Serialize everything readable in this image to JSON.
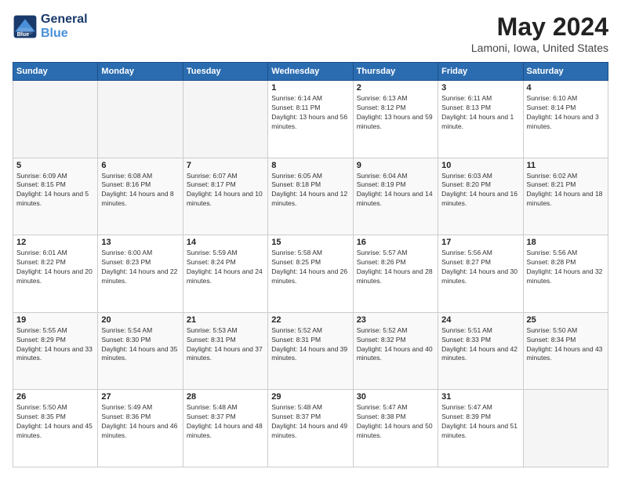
{
  "header": {
    "logo_line1": "General",
    "logo_line2": "Blue",
    "month_title": "May 2024",
    "location": "Lamoni, Iowa, United States"
  },
  "weekdays": [
    "Sunday",
    "Monday",
    "Tuesday",
    "Wednesday",
    "Thursday",
    "Friday",
    "Saturday"
  ],
  "weeks": [
    [
      {
        "day": "",
        "empty": true
      },
      {
        "day": "",
        "empty": true
      },
      {
        "day": "",
        "empty": true
      },
      {
        "day": "1",
        "sunrise": "6:14 AM",
        "sunset": "8:11 PM",
        "daylight": "13 hours and 56 minutes."
      },
      {
        "day": "2",
        "sunrise": "6:13 AM",
        "sunset": "8:12 PM",
        "daylight": "13 hours and 59 minutes."
      },
      {
        "day": "3",
        "sunrise": "6:11 AM",
        "sunset": "8:13 PM",
        "daylight": "14 hours and 1 minute."
      },
      {
        "day": "4",
        "sunrise": "6:10 AM",
        "sunset": "8:14 PM",
        "daylight": "14 hours and 3 minutes."
      }
    ],
    [
      {
        "day": "5",
        "sunrise": "6:09 AM",
        "sunset": "8:15 PM",
        "daylight": "14 hours and 5 minutes."
      },
      {
        "day": "6",
        "sunrise": "6:08 AM",
        "sunset": "8:16 PM",
        "daylight": "14 hours and 8 minutes."
      },
      {
        "day": "7",
        "sunrise": "6:07 AM",
        "sunset": "8:17 PM",
        "daylight": "14 hours and 10 minutes."
      },
      {
        "day": "8",
        "sunrise": "6:05 AM",
        "sunset": "8:18 PM",
        "daylight": "14 hours and 12 minutes."
      },
      {
        "day": "9",
        "sunrise": "6:04 AM",
        "sunset": "8:19 PM",
        "daylight": "14 hours and 14 minutes."
      },
      {
        "day": "10",
        "sunrise": "6:03 AM",
        "sunset": "8:20 PM",
        "daylight": "14 hours and 16 minutes."
      },
      {
        "day": "11",
        "sunrise": "6:02 AM",
        "sunset": "8:21 PM",
        "daylight": "14 hours and 18 minutes."
      }
    ],
    [
      {
        "day": "12",
        "sunrise": "6:01 AM",
        "sunset": "8:22 PM",
        "daylight": "14 hours and 20 minutes."
      },
      {
        "day": "13",
        "sunrise": "6:00 AM",
        "sunset": "8:23 PM",
        "daylight": "14 hours and 22 minutes."
      },
      {
        "day": "14",
        "sunrise": "5:59 AM",
        "sunset": "8:24 PM",
        "daylight": "14 hours and 24 minutes."
      },
      {
        "day": "15",
        "sunrise": "5:58 AM",
        "sunset": "8:25 PM",
        "daylight": "14 hours and 26 minutes."
      },
      {
        "day": "16",
        "sunrise": "5:57 AM",
        "sunset": "8:26 PM",
        "daylight": "14 hours and 28 minutes."
      },
      {
        "day": "17",
        "sunrise": "5:56 AM",
        "sunset": "8:27 PM",
        "daylight": "14 hours and 30 minutes."
      },
      {
        "day": "18",
        "sunrise": "5:56 AM",
        "sunset": "8:28 PM",
        "daylight": "14 hours and 32 minutes."
      }
    ],
    [
      {
        "day": "19",
        "sunrise": "5:55 AM",
        "sunset": "8:29 PM",
        "daylight": "14 hours and 33 minutes."
      },
      {
        "day": "20",
        "sunrise": "5:54 AM",
        "sunset": "8:30 PM",
        "daylight": "14 hours and 35 minutes."
      },
      {
        "day": "21",
        "sunrise": "5:53 AM",
        "sunset": "8:31 PM",
        "daylight": "14 hours and 37 minutes."
      },
      {
        "day": "22",
        "sunrise": "5:52 AM",
        "sunset": "8:31 PM",
        "daylight": "14 hours and 39 minutes."
      },
      {
        "day": "23",
        "sunrise": "5:52 AM",
        "sunset": "8:32 PM",
        "daylight": "14 hours and 40 minutes."
      },
      {
        "day": "24",
        "sunrise": "5:51 AM",
        "sunset": "8:33 PM",
        "daylight": "14 hours and 42 minutes."
      },
      {
        "day": "25",
        "sunrise": "5:50 AM",
        "sunset": "8:34 PM",
        "daylight": "14 hours and 43 minutes."
      }
    ],
    [
      {
        "day": "26",
        "sunrise": "5:50 AM",
        "sunset": "8:35 PM",
        "daylight": "14 hours and 45 minutes."
      },
      {
        "day": "27",
        "sunrise": "5:49 AM",
        "sunset": "8:36 PM",
        "daylight": "14 hours and 46 minutes."
      },
      {
        "day": "28",
        "sunrise": "5:48 AM",
        "sunset": "8:37 PM",
        "daylight": "14 hours and 48 minutes."
      },
      {
        "day": "29",
        "sunrise": "5:48 AM",
        "sunset": "8:37 PM",
        "daylight": "14 hours and 49 minutes."
      },
      {
        "day": "30",
        "sunrise": "5:47 AM",
        "sunset": "8:38 PM",
        "daylight": "14 hours and 50 minutes."
      },
      {
        "day": "31",
        "sunrise": "5:47 AM",
        "sunset": "8:39 PM",
        "daylight": "14 hours and 51 minutes."
      },
      {
        "day": "",
        "empty": true
      }
    ]
  ],
  "labels": {
    "sunrise": "Sunrise:",
    "sunset": "Sunset:",
    "daylight": "Daylight:"
  }
}
